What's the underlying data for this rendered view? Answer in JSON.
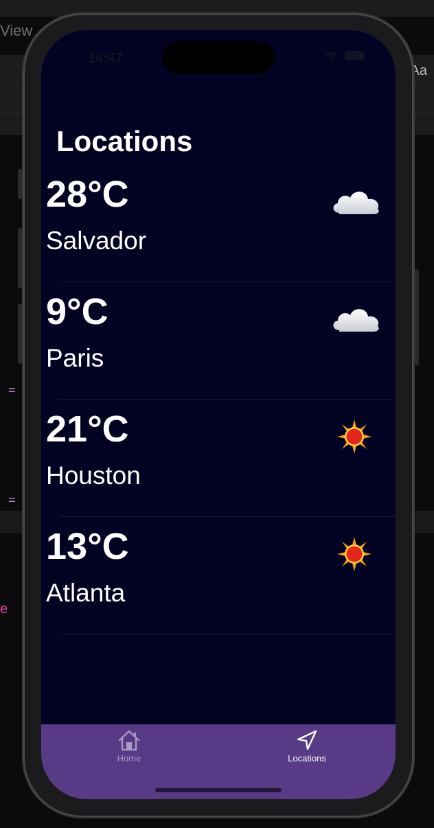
{
  "background": {
    "view_label": "View",
    "font_button_label": "Aa",
    "operator_top": "=",
    "operator_bottom": "=",
    "code_fragment": "e"
  },
  "status_bar": {
    "time": "16:47"
  },
  "page": {
    "title": "Locations"
  },
  "locations": [
    {
      "temperature": "28°C",
      "city": "Salvador",
      "icon": "cloud-icon"
    },
    {
      "temperature": "9°C",
      "city": "Paris",
      "icon": "cloud-icon"
    },
    {
      "temperature": "21°C",
      "city": "Houston",
      "icon": "sun-icon"
    },
    {
      "temperature": "13°C",
      "city": "Atlanta",
      "icon": "sun-icon"
    }
  ],
  "tab_bar": {
    "tabs": [
      {
        "label": "Home",
        "icon": "house-icon",
        "selected": false
      },
      {
        "label": "Locations",
        "icon": "location-arrow-icon",
        "selected": true
      }
    ]
  },
  "colors": {
    "screen_background": "#020322",
    "tab_bar": "#583a86",
    "text": "#ffffff"
  }
}
